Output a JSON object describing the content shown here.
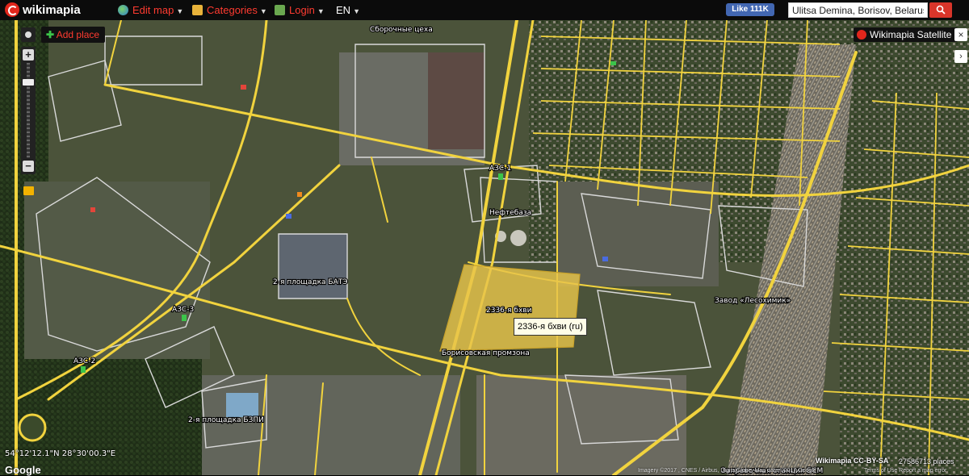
{
  "topbar": {
    "logo": "wikimapia",
    "menu": [
      {
        "label": "Edit map",
        "icon": "globe-icon"
      },
      {
        "label": "Categories",
        "icon": "folder-icon"
      },
      {
        "label": "Login",
        "icon": "key-icon"
      },
      {
        "label": "EN",
        "icon": ""
      }
    ],
    "facebook_like": "Like 111K",
    "search_value": "Ulitsa Demina, Borisov, Belarus",
    "search_button": "search-icon"
  },
  "controls": {
    "add_place": "Add place",
    "zoom_in": "+",
    "zoom_out": "−",
    "map_type": "Wikimapia Satellite",
    "close": "×",
    "side": "›"
  },
  "map": {
    "selected_place": {
      "label": "2336-я бхви",
      "tooltip": "2336-я бхви (ru)",
      "fill": "#e8c54a"
    },
    "labels": [
      "Сборочные цеха",
      "АЗС-1",
      "Нефтебаза",
      "2-я площадка БАТЭ",
      "Завод «Лесохимик»",
      "Борисовская промзона",
      "АЗС-3",
      "АЗС-2",
      "2-я площадка БЗПИ",
      "Заправочная станция БСМ"
    ],
    "road_color": "#f1d33e",
    "outline_color": "#d9d9d9"
  },
  "footer": {
    "coordinates": "54°12'12.1\"N 28°30'00.3\"E",
    "google": "Google",
    "license": "Wikimapia CC-BY-SA",
    "places_count": "27586713 places",
    "attribution": "Imagery ©2017 , CNES / Airbus, DigitalGlobe, Map data ©2017 Google",
    "terms": "Terms of Use   Report a map error"
  }
}
